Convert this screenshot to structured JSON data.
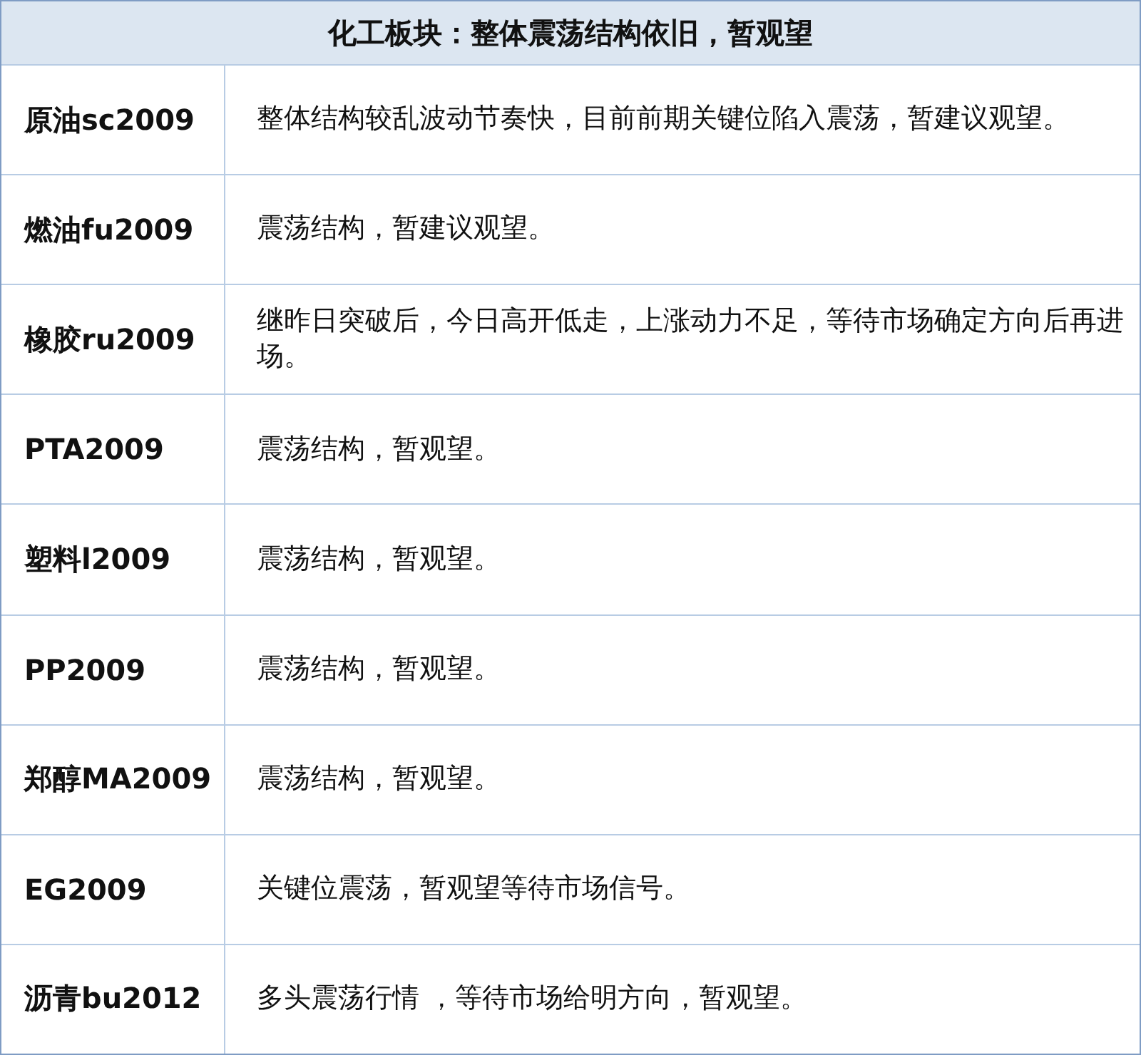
{
  "table": {
    "title": "化工板块：整体震荡结构依旧，暂观望",
    "rows": [
      {
        "name": "原油sc2009",
        "comment": "整体结构较乱波动节奏快，目前前期关键位陷入震荡，暂建议观望。"
      },
      {
        "name": "燃油fu2009",
        "comment": "震荡结构，暂建议观望。"
      },
      {
        "name": "橡胶ru2009",
        "comment": "继昨日突破后，今日高开低走，上涨动力不足，等待市场确定方向后再进场。"
      },
      {
        "name": "PTA2009",
        "comment": "震荡结构，暂观望。"
      },
      {
        "name": "塑料l2009",
        "comment": "震荡结构，暂观望。"
      },
      {
        "name": "PP2009",
        "comment": "震荡结构，暂观望。"
      },
      {
        "name": "郑醇MA2009",
        "comment": "震荡结构，暂观望。"
      },
      {
        "name": "EG2009",
        "comment": "关键位震荡，暂观望等待市场信号。"
      },
      {
        "name": "沥青bu2012",
        "comment": "多头震荡行情 ，等待市场给明方向，暂观望。"
      }
    ]
  }
}
